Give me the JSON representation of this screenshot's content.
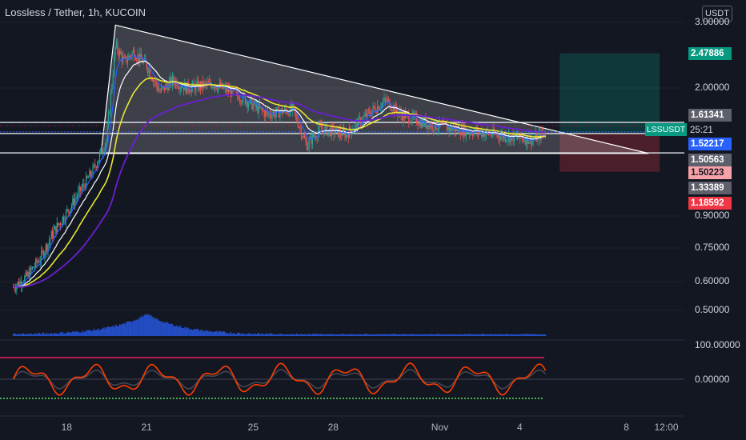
{
  "header": {
    "title": "Lossless / Tether, 1h, KUCOIN",
    "unit": "USDT"
  },
  "chart_data": {
    "type": "line",
    "symbol": "LSSUSDT",
    "interval": "1h",
    "exchange": "KUCOIN",
    "y_scale": "log",
    "ylim": [
      0.52,
      3.0
    ],
    "y_ticks": [
      "3.00000",
      "2.00000",
      "0.90000",
      "0.75000",
      "0.60000",
      "0.50000"
    ],
    "x_ticks": [
      "18",
      "21",
      "25",
      "28",
      "Nov",
      "4",
      "8",
      "12:00"
    ],
    "price_labels": [
      {
        "text": "2.47886",
        "value": 2.47886,
        "style": "target"
      },
      {
        "text": "1.61341",
        "value": 1.61341,
        "style": "level"
      },
      {
        "text": "1.52217",
        "value": 1.52217,
        "style": "last"
      },
      {
        "text": "1.50563",
        "value": 1.50563,
        "style": "level"
      },
      {
        "text": "1.50223",
        "value": 1.50223,
        "style": "stop"
      },
      {
        "text": "1.33389",
        "value": 1.33389,
        "style": "level"
      },
      {
        "text": "1.18592",
        "value": 1.18592,
        "style": "red"
      }
    ],
    "countdown": "25:21",
    "triangle": [
      [
        "2021-10-19T20:00",
        2.95
      ],
      [
        "2021-11-08T20:00",
        1.33
      ],
      [
        "2021-10-19T07:00",
        1.33
      ]
    ],
    "horizontal_levels": [
      1.61341,
      1.50563,
      1.33389
    ],
    "position": {
      "entry": 1.50563,
      "target": 2.47886,
      "stop": 1.18592
    },
    "price_path": [
      [
        "2021-10-16T00:00",
        0.58
      ],
      [
        "2021-10-16T12:00",
        0.62
      ],
      [
        "2021-10-17T00:00",
        0.7
      ],
      [
        "2021-10-17T12:00",
        0.82
      ],
      [
        "2021-10-18T00:00",
        0.92
      ],
      [
        "2021-10-18T12:00",
        1.05
      ],
      [
        "2021-10-19T00:00",
        1.2
      ],
      [
        "2021-10-19T12:00",
        1.45
      ],
      [
        "2021-10-19T20:00",
        2.6
      ],
      [
        "2021-10-20T04:00",
        2.35
      ],
      [
        "2021-10-20T12:00",
        2.5
      ],
      [
        "2021-10-21T00:00",
        2.3
      ],
      [
        "2021-10-21T12:00",
        1.95
      ],
      [
        "2021-10-22T00:00",
        2.1
      ],
      [
        "2021-10-22T12:00",
        2.0
      ],
      [
        "2021-10-23T12:00",
        2.05
      ],
      [
        "2021-10-24T12:00",
        1.9
      ],
      [
        "2021-10-25T12:00",
        1.7
      ],
      [
        "2021-10-26T12:00",
        1.75
      ],
      [
        "2021-10-27T00:00",
        1.4
      ],
      [
        "2021-10-27T12:00",
        1.55
      ],
      [
        "2021-10-28T12:00",
        1.5
      ],
      [
        "2021-10-29T12:00",
        1.75
      ],
      [
        "2021-10-30T00:00",
        1.85
      ],
      [
        "2021-10-30T12:00",
        1.7
      ],
      [
        "2021-10-31T12:00",
        1.6
      ],
      [
        "2021-11-01T12:00",
        1.55
      ],
      [
        "2021-11-02T12:00",
        1.52
      ],
      [
        "2021-11-03T12:00",
        1.48
      ],
      [
        "2021-11-04T12:00",
        1.45
      ],
      [
        "2021-11-05T00:00",
        1.52
      ]
    ],
    "colors": {
      "bg": "#131722",
      "up": "#26a69a",
      "down": "#ef5350",
      "ema_fast": "#2962ff",
      "ema_mid": "#ffffff",
      "ema_slow": "#e8e533",
      "ema_long": "#6a1fd1",
      "volume": "#2962ff",
      "osc": "#ff3d00",
      "osc_top": "#e91e63",
      "osc_bottom": "#4caf50"
    },
    "volume_peak_date": "2021-10-21T00:00",
    "oscillator": {
      "levels": [
        {
          "text": "100.00000",
          "value": 100
        },
        {
          "text": "0.00000",
          "value": 0
        }
      ]
    }
  }
}
